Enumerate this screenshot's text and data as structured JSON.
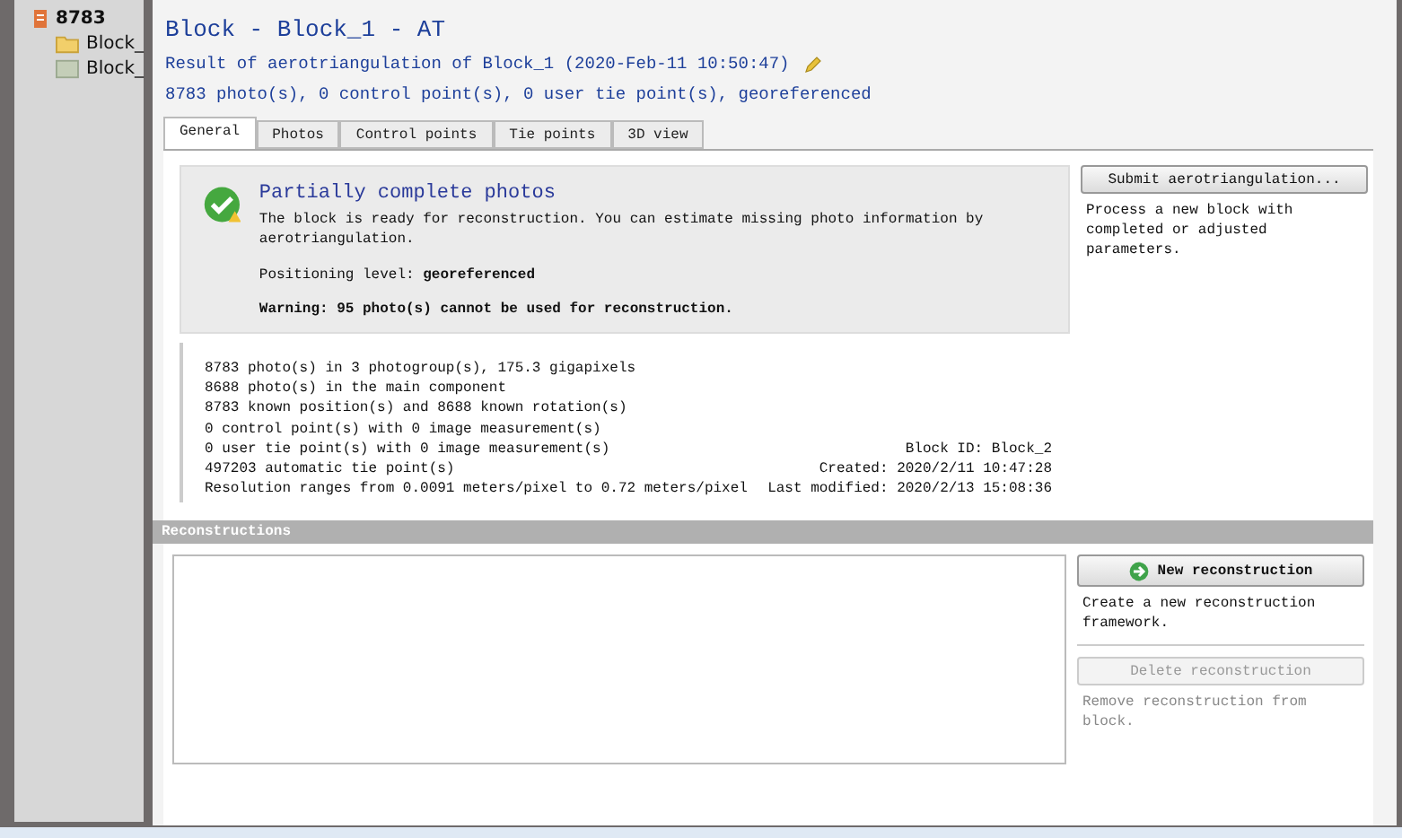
{
  "tree": [
    {
      "label": "8783",
      "kind": "project",
      "children": [
        {
          "label": "Block_",
          "kind": "folder"
        },
        {
          "label": "Block_",
          "kind": "block"
        }
      ]
    }
  ],
  "header": {
    "title": "Block - Block_1 - AT",
    "subtitle": "Result of aerotriangulation of Block_1 (2020-Feb-11 10:50:47)",
    "summary": "8783 photo(s), 0 control point(s), 0 user tie point(s), georeferenced"
  },
  "tabs": [
    {
      "label": "General",
      "selected": true
    },
    {
      "label": "Photos",
      "selected": false
    },
    {
      "label": "Control points",
      "selected": false
    },
    {
      "label": "Tie points",
      "selected": false
    },
    {
      "label": "3D view",
      "selected": false
    }
  ],
  "status": {
    "title": "Partially complete photos",
    "message": "The block is ready for reconstruction. You can estimate missing photo information by aerotriangulation.",
    "positioning": "Positioning level: **georeferenced**",
    "warning": "Warning: 95 photo(s) cannot be used for reconstruction."
  },
  "info_lines": [
    {
      "left": "8783 photo(s) in 3 photogroup(s), 175.3 gigapixels"
    },
    {
      "left": "8688 photo(s) in the main component"
    },
    {
      "left": "8783 known position(s) and 8688 known rotation(s)"
    },
    {
      "left": "0 control point(s) with 0 image measurement(s)"
    },
    {
      "left": "0 user tie point(s) with 0 image measurement(s)",
      "right": "Block ID: Block_2"
    },
    {
      "left": "497203 automatic tie point(s)",
      "right": "Created: 2020/2/11 10:47:28"
    },
    {
      "left": "Resolution ranges from 0.0091 meters/pixel to 0.72 meters/pixel",
      "right": "Last modified: 2020/2/13 15:08:36"
    }
  ],
  "general_actions": [
    {
      "label": "Submit aerotriangulation...",
      "description": "Process a new block with completed or adjusted parameters.",
      "disabled": false
    }
  ],
  "reconstructions": {
    "title": "Reconstructions",
    "actions": [
      {
        "label": "New reconstruction",
        "description": "Create a new reconstruction framework.",
        "kind": "add",
        "disabled": false
      },
      {
        "label": "Delete reconstruction",
        "description": "Remove reconstruction from block.",
        "kind": "plain",
        "disabled": true
      }
    ]
  }
}
